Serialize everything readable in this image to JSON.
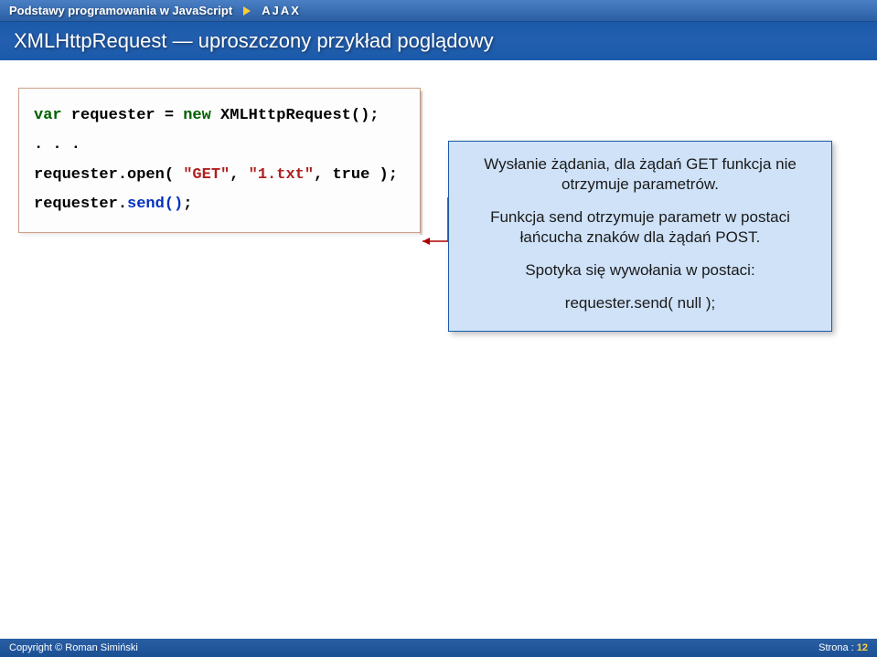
{
  "header": {
    "breadcrumb_left": "Podstawy programowania w JavaScript",
    "breadcrumb_right": "AJAX"
  },
  "title": "XMLHttpRequest — uproszczony przykład poglądowy",
  "code": {
    "line1_var": "var",
    "line1_requester": " requester = ",
    "line1_new": "new",
    "line1_ctor": " XMLHttpRequest();",
    "line2": ". . .",
    "line3_obj": "requester.open( ",
    "line3_arg1": "\"GET\"",
    "line3_comma1": ", ",
    "line3_arg2": "\"1.txt\"",
    "line3_comma2": ", true );",
    "line4_obj": "requester.",
    "line4_send": "send()",
    "line4_semi": ";"
  },
  "info": {
    "p1": "Wysłanie żądania, dla żądań GET funkcja nie otrzymuje parametrów.",
    "p2": "Funkcja send otrzymuje parametr w postaci łańcucha znaków dla żądań POST.",
    "p3": "Spotyka się wywołania w  postaci:",
    "p4": "requester.send( null );"
  },
  "footer": {
    "copyright": "Copyright © Roman Simiński",
    "page_label": "Strona :",
    "page_number": "12"
  }
}
